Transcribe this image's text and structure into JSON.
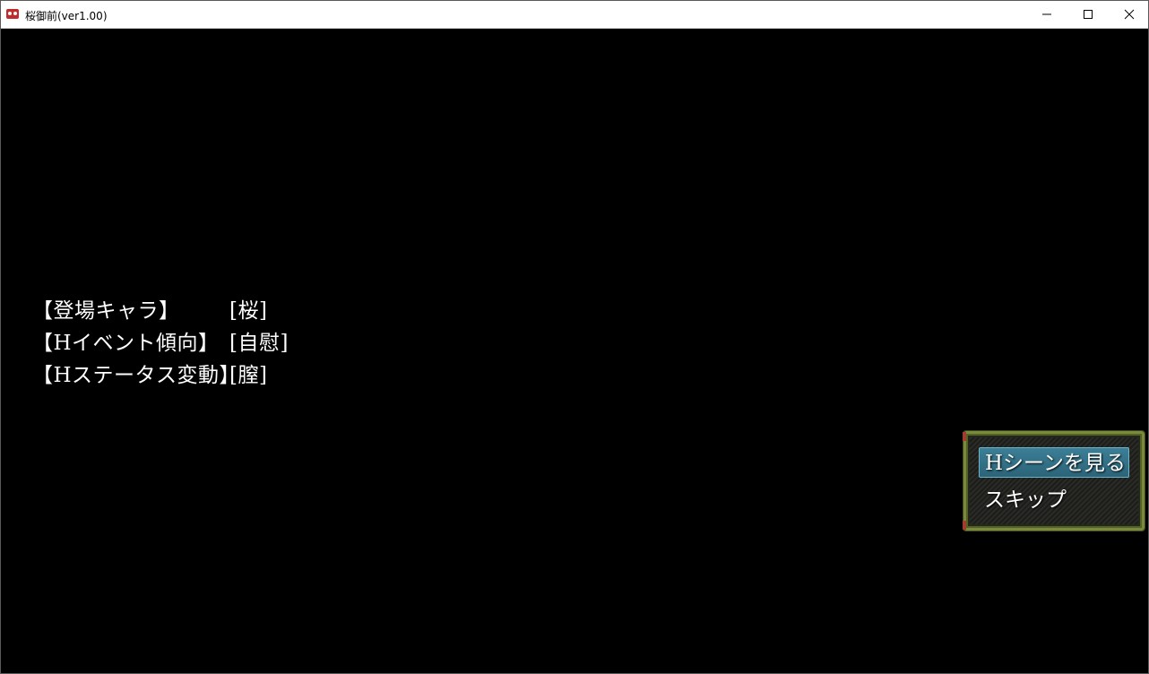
{
  "window": {
    "title": "桜御前(ver1.00)"
  },
  "info": [
    {
      "label": "【登場キャラ】",
      "value": "[桜]"
    },
    {
      "label": "【Hイベント傾向】",
      "value": "[自慰]"
    },
    {
      "label": "【Hステータス変動】",
      "value": "[膣]"
    }
  ],
  "choices": [
    {
      "label": "Hシーンを見る",
      "selected": true
    },
    {
      "label": "スキップ",
      "selected": false
    }
  ],
  "colors": {
    "background": "#000000",
    "text": "#ffffff",
    "selection": "#2f6d84",
    "frame": "#7a8a3c"
  }
}
